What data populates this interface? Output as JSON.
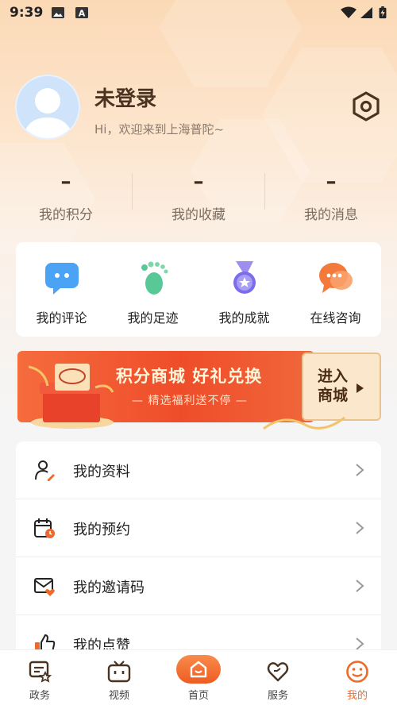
{
  "status_bar": {
    "time": "9:39"
  },
  "profile": {
    "name": "未登录",
    "greeting": "Hi，欢迎来到上海普陀~"
  },
  "stats": [
    {
      "value": "–",
      "label": "我的积分"
    },
    {
      "value": "–",
      "label": "我的收藏"
    },
    {
      "value": "–",
      "label": "我的消息"
    }
  ],
  "quick_actions": [
    {
      "label": "我的评论",
      "icon": "comment-bubble-icon"
    },
    {
      "label": "我的足迹",
      "icon": "footprint-icon"
    },
    {
      "label": "我的成就",
      "icon": "medal-icon"
    },
    {
      "label": "在线咨询",
      "icon": "chat-consult-icon"
    }
  ],
  "banner": {
    "title": "积分商城 好礼兑换",
    "subtitle": "— 精选福利送不停 —",
    "cta": "进入商城"
  },
  "menu": [
    {
      "label": "我的资料",
      "icon": "profile-edit-icon"
    },
    {
      "label": "我的预约",
      "icon": "calendar-clock-icon"
    },
    {
      "label": "我的邀请码",
      "icon": "mail-heart-icon"
    },
    {
      "label": "我的点赞",
      "icon": "thumbs-up-icon"
    }
  ],
  "tabbar": [
    {
      "label": "政务",
      "icon": "gov-affairs-icon"
    },
    {
      "label": "视频",
      "icon": "tv-icon"
    },
    {
      "label": "首页",
      "icon": "home-icon"
    },
    {
      "label": "服务",
      "icon": "heart-hand-icon"
    },
    {
      "label": "我的",
      "icon": "smiley-icon",
      "active": true
    }
  ],
  "colors": {
    "accent": "#ee6a2a",
    "banner_red": "#ef4d2a",
    "hero_top": "#fbd9b6"
  }
}
